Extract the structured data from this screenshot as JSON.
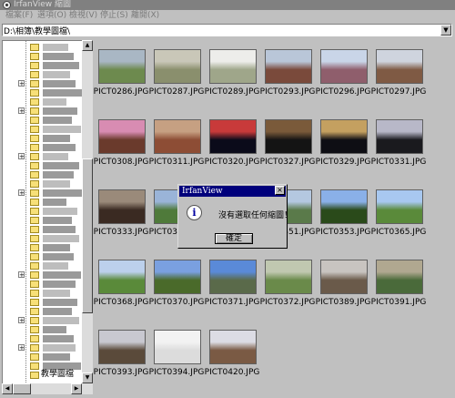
{
  "window": {
    "title": "IrfanView 縮圖"
  },
  "menu": [
    "檔案(F)",
    "選項(O)",
    "檢視(V)",
    "停止(S)",
    "離開(X)"
  ],
  "path": {
    "value": "D:\\相簿\\教學圖檔\\"
  },
  "tree": {
    "selected_label": "教學圖檔"
  },
  "thumbnails": [
    {
      "name": "PICT0286.JPG",
      "colors": [
        "#6d8a4e",
        "#a9b7c4"
      ]
    },
    {
      "name": "PICT0287.JPG",
      "colors": [
        "#8a8f6d",
        "#c9c7b8"
      ]
    },
    {
      "name": "PICT0289.JPG",
      "colors": [
        "#9fa68a",
        "#ededea"
      ]
    },
    {
      "name": "PICT0293.JPG",
      "colors": [
        "#7a4a3b",
        "#b9c6d8"
      ]
    },
    {
      "name": "PICT0296.JPG",
      "colors": [
        "#8f5e6c",
        "#c9d5e8"
      ]
    },
    {
      "name": "PICT0297.JPG",
      "colors": [
        "#7f5a44",
        "#cfd4de"
      ]
    },
    {
      "name": "PICT0308.JPG",
      "colors": [
        "#6a3a2c",
        "#d88cb2"
      ]
    },
    {
      "name": "PICT0311.JPG",
      "colors": [
        "#8d4d35",
        "#c6a082"
      ]
    },
    {
      "name": "PICT0320.JPG",
      "colors": [
        "#0b0b1a",
        "#c83a3a"
      ]
    },
    {
      "name": "PICT0327.JPG",
      "colors": [
        "#141414",
        "#7a5a3a"
      ]
    },
    {
      "name": "PICT0329.JPG",
      "colors": [
        "#0e0e14",
        "#c4a060"
      ]
    },
    {
      "name": "PICT0331.JPG",
      "colors": [
        "#1a1a1e",
        "#b8b8c8"
      ]
    },
    {
      "name": "PICT0333.JPG",
      "colors": [
        "#3a2a22",
        "#9a8a7a"
      ]
    },
    {
      "name": "PICT0334.JPG",
      "colors": [
        "#4f7a3a",
        "#9ab4d8"
      ]
    },
    {
      "name": "PICT0339.JPG",
      "colors": [
        "#6a8a5a",
        "#c8c8c8"
      ]
    },
    {
      "name": "PICT0351.JPG",
      "colors": [
        "#5a7a4a",
        "#b4c8e0"
      ]
    },
    {
      "name": "PICT0353.JPG",
      "colors": [
        "#2a4a1a",
        "#8ab0e8"
      ]
    },
    {
      "name": "PICT0365.JPG",
      "colors": [
        "#5a8a3a",
        "#a8c8f0"
      ]
    },
    {
      "name": "PICT0368.JPG",
      "colors": [
        "#5a8a3a",
        "#bcd0ec"
      ]
    },
    {
      "name": "PICT0370.JPG",
      "colors": [
        "#4a6a2a",
        "#7aa0e0"
      ]
    },
    {
      "name": "PICT0371.JPG",
      "colors": [
        "#5a6a4a",
        "#5a8ad8"
      ]
    },
    {
      "name": "PICT0372.JPG",
      "colors": [
        "#6a8a4a",
        "#c0c8b0"
      ]
    },
    {
      "name": "PICT0389.JPG",
      "colors": [
        "#6a5a4a",
        "#c8c4c0"
      ]
    },
    {
      "name": "PICT0391.JPG",
      "colors": [
        "#4a6a3a",
        "#b0a890"
      ]
    },
    {
      "name": "PICT0393.JPG",
      "colors": [
        "#5a4a3a",
        "#c8c8d0"
      ]
    },
    {
      "name": "PICT0394.JPG",
      "colors": [
        "#dcdcdc",
        "#f2f2f2"
      ]
    },
    {
      "name": "PICT0420.JPG",
      "colors": [
        "#7a5a44",
        "#dcdce4"
      ]
    }
  ],
  "dialog": {
    "title": "IrfanView",
    "message": "沒有選取任何縮圖！",
    "ok_label": "確定"
  }
}
